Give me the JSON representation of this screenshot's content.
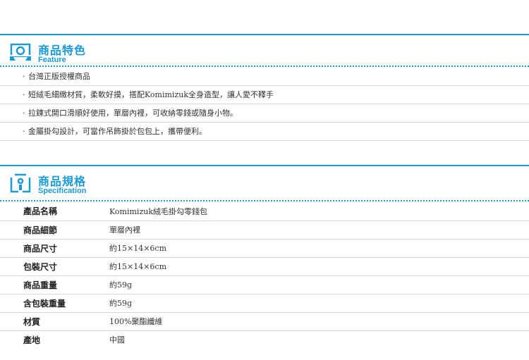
{
  "feature_section": {
    "title": "商品特色",
    "subtitle": "Feature",
    "icon": "camera-icon",
    "accent_color": "#1a9ad6",
    "items": [
      "台灣正版授權商品",
      "短絨毛細緻材質，柔軟好摸，搭配Komimizuk全身造型，讓人愛不釋手",
      "拉鍊式開口滑順好使用，單層內裡，可收納零錢或隨身小物。",
      "金屬掛勾設計，可當作吊飾掛於包包上，攜帶便利。"
    ]
  },
  "spec_section": {
    "title": "商品規格",
    "subtitle": "Specification",
    "icon": "document-icon",
    "rows": [
      {
        "label": "產品名稱",
        "value": "Komimizuk絨毛掛勾零錢包"
      },
      {
        "label": "商品細節",
        "value": "單層內裡"
      },
      {
        "label": "商品尺寸",
        "value": "約15×14×6cm"
      },
      {
        "label": "包裝尺寸",
        "value": "約15×14×6cm"
      },
      {
        "label": "商品重量",
        "value": "約59g"
      },
      {
        "label": "含包裝重量",
        "value": "約59g"
      },
      {
        "label": "材質",
        "value": "100%聚酯纖維"
      },
      {
        "label": "產地",
        "value": "中國"
      }
    ]
  }
}
